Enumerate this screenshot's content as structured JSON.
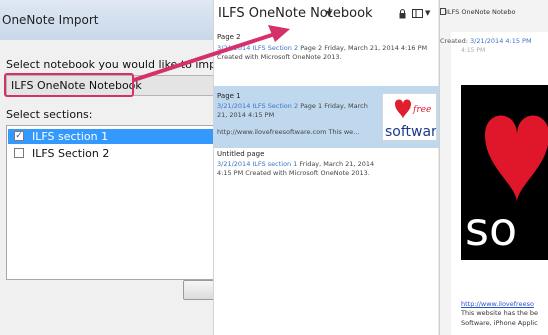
{
  "dialog": {
    "title": "OneNote Import",
    "select_notebook_label": "Select notebook you would like to import:",
    "notebook_value": "ILFS OneNote Notebook",
    "select_sections_label": "Select sections:",
    "sections": [
      {
        "label": "ILFS section 1",
        "checked": true,
        "selected": true
      },
      {
        "label": "ILFS Section 2",
        "checked": false,
        "selected": false
      }
    ]
  },
  "notebook": {
    "title": "ILFS OneNote Notebook",
    "pages": [
      {
        "title": "Page 2",
        "meta_blue": "3/21/2014  ILFS Section 2",
        "meta": "Page 2 Friday, March 21, 2014 4:16 PM Created with Microsoft OneNote 2013."
      },
      {
        "title": "Page 1",
        "meta_blue": "3/21/2014  ILFS Section 2",
        "meta": "Page 1 Friday, March 21, 2014 4:15 PM",
        "meta2": "http://www.ilovefreesoftware.com This we..."
      },
      {
        "title": "Untitled page",
        "meta_blue": "3/21/2014  ILFS section 1",
        "meta": "Friday, March 21, 2014 4:15 PM Created with Microsoft OneNote 2013."
      }
    ],
    "thumb_logo_top": "free",
    "thumb_logo_bottom": "software"
  },
  "content": {
    "title": "ILFS OneNote Notebo",
    "created_label": "Created:",
    "created_value": "3/21/2014 4:15 PM",
    "time_text": "4:15 PM",
    "logo_bottom": "so",
    "link_text": "http://www.ilovefreeso",
    "line1": "This website has the be",
    "line2": "Software, iPhone Applic"
  },
  "colors": {
    "accent": "#d6306a",
    "selection": "#3399ff",
    "page_selected": "#bfd8ed",
    "link_blue": "#3a74c5"
  }
}
